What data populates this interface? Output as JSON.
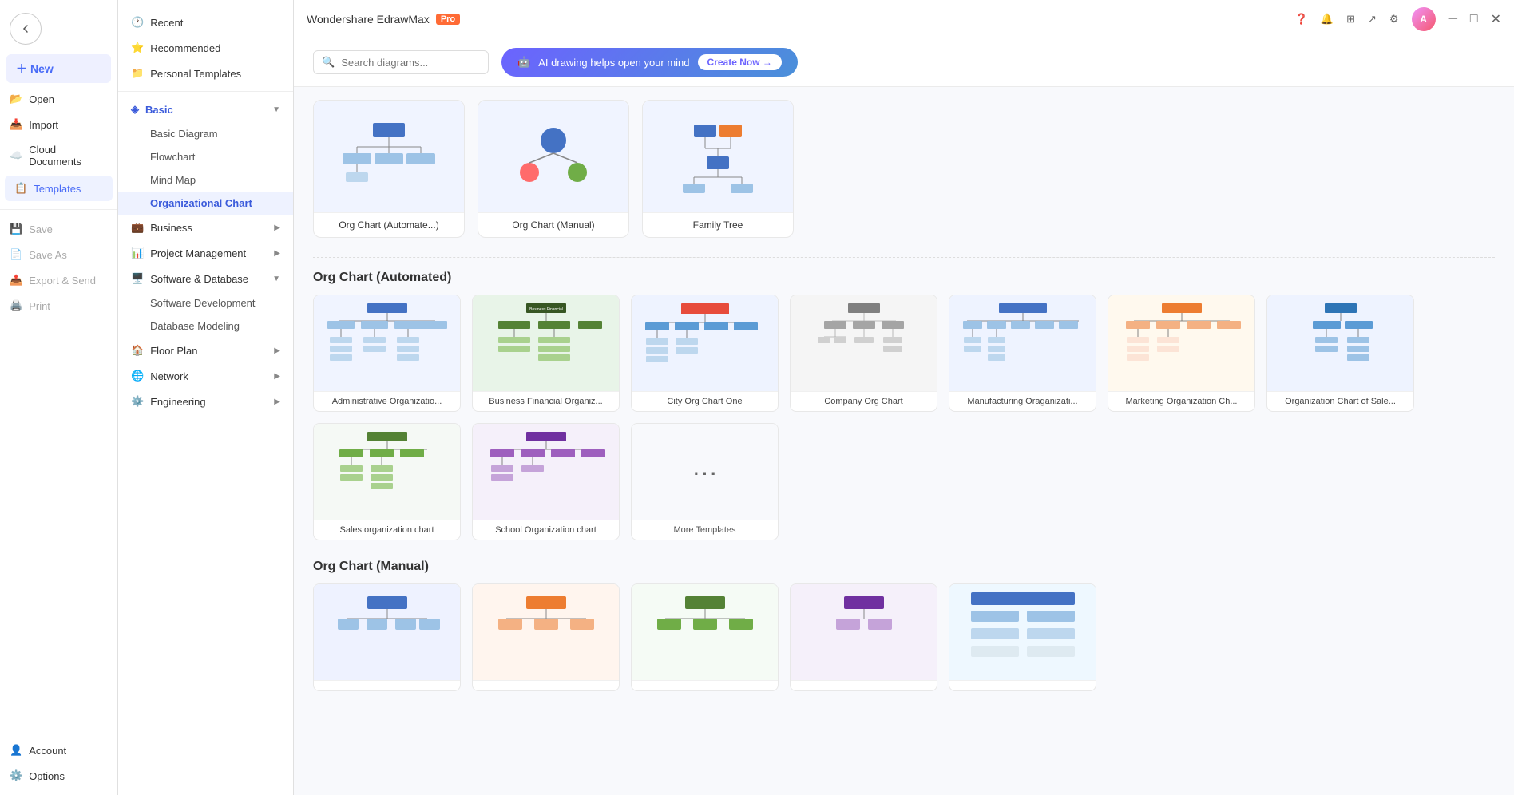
{
  "app": {
    "title": "Wondershare EdrawMax",
    "pro_badge": "Pro"
  },
  "topbar": {
    "right_icons": [
      "question-icon",
      "bell-icon",
      "grid-icon",
      "share-icon",
      "settings-icon"
    ],
    "avatar_initials": "A"
  },
  "search": {
    "placeholder": "Search diagrams..."
  },
  "ai_banner": {
    "text": "AI drawing helps open your mind",
    "cta": "Create Now →"
  },
  "left_nav": {
    "back": "back",
    "items": [
      {
        "id": "new",
        "label": "New",
        "icon": "➕"
      },
      {
        "id": "open",
        "label": "Open",
        "icon": "📂"
      },
      {
        "id": "import",
        "label": "Import",
        "icon": "📥"
      },
      {
        "id": "cloud",
        "label": "Cloud Documents",
        "icon": "☁️"
      },
      {
        "id": "templates",
        "label": "Templates",
        "icon": "📋",
        "active": true
      },
      {
        "id": "save",
        "label": "Save",
        "icon": "💾"
      },
      {
        "id": "saveas",
        "label": "Save As",
        "icon": "📄"
      },
      {
        "id": "export",
        "label": "Export & Send",
        "icon": "📤"
      },
      {
        "id": "print",
        "label": "Print",
        "icon": "🖨️"
      }
    ],
    "bottom_items": [
      {
        "id": "account",
        "label": "Account",
        "icon": "👤"
      },
      {
        "id": "options",
        "label": "Options",
        "icon": "⚙️"
      }
    ]
  },
  "tree_nav": {
    "top_items": [
      {
        "id": "recent",
        "label": "Recent",
        "icon": "🕐"
      },
      {
        "id": "recommended",
        "label": "Recommended",
        "icon": "⭐"
      },
      {
        "id": "personal",
        "label": "Personal Templates",
        "icon": "📁"
      }
    ],
    "sections": [
      {
        "id": "basic",
        "label": "Basic",
        "icon": "◈",
        "active": true,
        "expanded": true,
        "children": [
          {
            "id": "basic-diagram",
            "label": "Basic Diagram"
          },
          {
            "id": "flowchart",
            "label": "Flowchart"
          },
          {
            "id": "mind-map",
            "label": "Mind Map"
          },
          {
            "id": "org-chart",
            "label": "Organizational Chart",
            "active": true
          }
        ]
      },
      {
        "id": "business",
        "label": "Business",
        "icon": "💼",
        "expanded": false,
        "children": []
      },
      {
        "id": "project",
        "label": "Project Management",
        "icon": "📊",
        "expanded": false,
        "children": []
      },
      {
        "id": "software",
        "label": "Software & Database",
        "icon": "🖥️",
        "expanded": true,
        "children": [
          {
            "id": "software-dev",
            "label": "Software Development"
          },
          {
            "id": "db-modeling",
            "label": "Database Modeling"
          }
        ]
      },
      {
        "id": "floor",
        "label": "Floor Plan",
        "icon": "🏠",
        "expanded": false,
        "children": []
      },
      {
        "id": "network",
        "label": "Network",
        "icon": "🌐",
        "expanded": false,
        "children": []
      },
      {
        "id": "engineering",
        "label": "Engineering",
        "icon": "⚙️",
        "expanded": false,
        "children": []
      }
    ]
  },
  "top_templates": [
    {
      "id": "org-auto",
      "label": "Org Chart (Automate...)"
    },
    {
      "id": "org-manual",
      "label": "Org Chart (Manual)"
    },
    {
      "id": "family-tree",
      "label": "Family Tree"
    }
  ],
  "sections": [
    {
      "id": "org-automated",
      "title": "Org Chart (Automated)",
      "templates": [
        {
          "id": "admin-org",
          "label": "Administrative Organizatio..."
        },
        {
          "id": "business-fin",
          "label": "Business Financial Organiz..."
        },
        {
          "id": "city-org",
          "label": "City Org Chart One"
        },
        {
          "id": "company-org",
          "label": "Company Org Chart"
        },
        {
          "id": "manufacturing",
          "label": "Manufacturing Oraganizati..."
        },
        {
          "id": "marketing-org",
          "label": "Marketing Organization Ch..."
        },
        {
          "id": "org-sales",
          "label": "Organization Chart of Sale..."
        },
        {
          "id": "sales-org",
          "label": "Sales organization chart"
        },
        {
          "id": "school-org",
          "label": "School Organization chart"
        },
        {
          "id": "more-templates",
          "label": "More Templates",
          "is_more": true
        }
      ]
    },
    {
      "id": "org-manual",
      "title": "Org Chart (Manual)",
      "templates": [
        {
          "id": "manual-1",
          "label": ""
        },
        {
          "id": "manual-2",
          "label": ""
        },
        {
          "id": "manual-3",
          "label": ""
        },
        {
          "id": "manual-4",
          "label": ""
        },
        {
          "id": "manual-5",
          "label": ""
        }
      ]
    }
  ]
}
